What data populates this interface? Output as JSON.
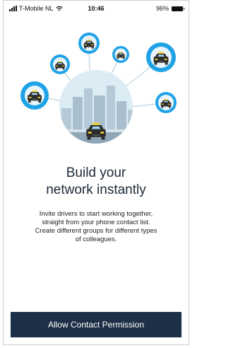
{
  "status_bar": {
    "carrier": "T-Mobile NL",
    "time": "10:46",
    "battery": "96%"
  },
  "illustration": {
    "icons": [
      "taxi-icon",
      "city-skyline-icon",
      "wifi-icon",
      "signal-icon",
      "battery-icon"
    ],
    "colors": {
      "bubble_blue": "#1fa3e6",
      "center_circle": "#dcecf5",
      "skyline": "#a9bfcd",
      "taxi_yellow": "#f7d23a",
      "taxi_body": "#2b2b2b"
    }
  },
  "onboarding": {
    "title_line1": "Build your",
    "title_line2": "network instantly",
    "description_line1": "Invite drivers to start working together,",
    "description_line2": "straight from your phone contact list.",
    "description_line3": "Create different groups for different types",
    "description_line4": "of colleagues."
  },
  "actions": {
    "allow_contacts_label": "Allow Contact Permission"
  },
  "theme": {
    "button_bg": "#1d3047",
    "button_text": "#ffffff"
  }
}
